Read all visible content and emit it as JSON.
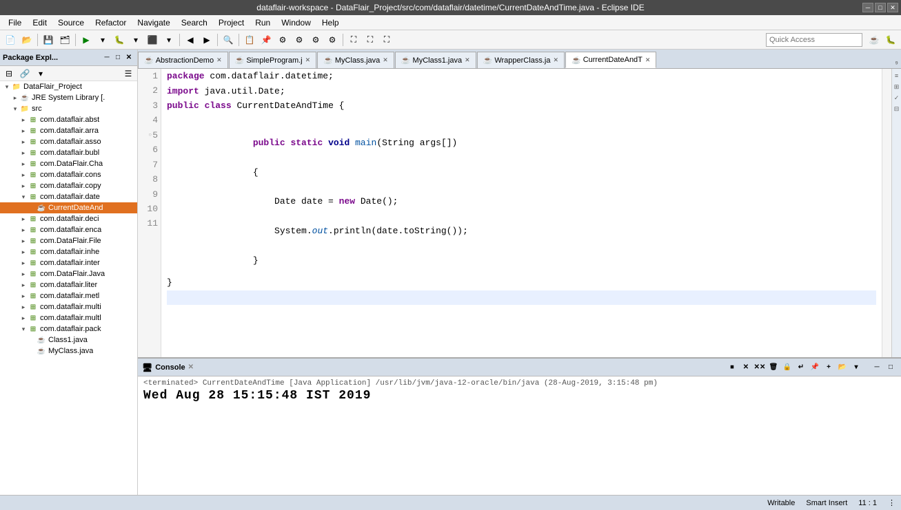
{
  "titleBar": {
    "title": "dataflair-workspace - DataFlair_Project/src/com/dataflair/datetime/CurrentDateAndTime.java - Eclipse IDE",
    "controls": [
      "minimize",
      "maximize",
      "close"
    ]
  },
  "menuBar": {
    "items": [
      "File",
      "Edit",
      "Source",
      "Refactor",
      "Navigate",
      "Search",
      "Project",
      "Run",
      "Window",
      "Help"
    ]
  },
  "toolbar": {
    "quickAccess": {
      "placeholder": "Quick Access",
      "label": "Quick Access"
    }
  },
  "packageExplorer": {
    "title": "Package Expl...",
    "tree": [
      {
        "level": 1,
        "type": "project",
        "label": "DataFlair_Project",
        "expanded": true,
        "arrow": "▾"
      },
      {
        "level": 2,
        "type": "jre",
        "label": "JRE System Library [.",
        "expanded": false,
        "arrow": "▸"
      },
      {
        "level": 2,
        "type": "folder",
        "label": "src",
        "expanded": true,
        "arrow": "▾"
      },
      {
        "level": 3,
        "type": "package",
        "label": "com.dataflair.abst",
        "expanded": false,
        "arrow": "▸"
      },
      {
        "level": 3,
        "type": "package",
        "label": "com.dataflair.arra",
        "expanded": false,
        "arrow": "▸"
      },
      {
        "level": 3,
        "type": "package",
        "label": "com.dataflair.asso",
        "expanded": false,
        "arrow": "▸"
      },
      {
        "level": 3,
        "type": "package",
        "label": "com.dataflair.bubl",
        "expanded": false,
        "arrow": "▸"
      },
      {
        "level": 3,
        "type": "package",
        "label": "com.DataFlair.Cha",
        "expanded": false,
        "arrow": "▸"
      },
      {
        "level": 3,
        "type": "package",
        "label": "com.dataflair.cons",
        "expanded": false,
        "arrow": "▸"
      },
      {
        "level": 3,
        "type": "package",
        "label": "com.dataflair.copy",
        "expanded": false,
        "arrow": "▸"
      },
      {
        "level": 3,
        "type": "package",
        "label": "com.dataflair.date",
        "expanded": true,
        "arrow": "▾"
      },
      {
        "level": 4,
        "type": "java",
        "label": "CurrentDateAnd",
        "selected": true,
        "arrow": ""
      },
      {
        "level": 3,
        "type": "package",
        "label": "com.dataflair.deci",
        "expanded": false,
        "arrow": "▸"
      },
      {
        "level": 3,
        "type": "package",
        "label": "com.dataflair.enca",
        "expanded": false,
        "arrow": "▸"
      },
      {
        "level": 3,
        "type": "package",
        "label": "com.DataFlair.File",
        "expanded": false,
        "arrow": "▸"
      },
      {
        "level": 3,
        "type": "package",
        "label": "com.dataflair.inhe",
        "expanded": false,
        "arrow": "▸"
      },
      {
        "level": 3,
        "type": "package",
        "label": "com.dataflair.inter",
        "expanded": false,
        "arrow": "▸"
      },
      {
        "level": 3,
        "type": "package",
        "label": "com.DataFlair.Java",
        "expanded": false,
        "arrow": "▸"
      },
      {
        "level": 3,
        "type": "package",
        "label": "com.dataflair.liter",
        "expanded": false,
        "arrow": "▸"
      },
      {
        "level": 3,
        "type": "package",
        "label": "com.dataflair.metl",
        "expanded": false,
        "arrow": "▸"
      },
      {
        "level": 3,
        "type": "package",
        "label": "com.dataflair.multi",
        "expanded": false,
        "arrow": "▸"
      },
      {
        "level": 3,
        "type": "package",
        "label": "com.dataflair.multl",
        "expanded": false,
        "arrow": "▸"
      },
      {
        "level": 3,
        "type": "package",
        "label": "com.dataflair.pack",
        "expanded": true,
        "arrow": "▾"
      },
      {
        "level": 4,
        "type": "java",
        "label": "Class1.java",
        "selected": false,
        "arrow": ""
      },
      {
        "level": 4,
        "type": "java",
        "label": "MyClass.java",
        "selected": false,
        "arrow": ""
      }
    ]
  },
  "editorTabs": {
    "tabs": [
      {
        "label": "AbstractionDemo",
        "active": false,
        "closable": true
      },
      {
        "label": "SimpleProgram.j",
        "active": false,
        "closable": true
      },
      {
        "label": "MyClass.java",
        "active": false,
        "closable": true
      },
      {
        "label": "MyClass1.java",
        "active": false,
        "closable": true
      },
      {
        "label": "WrapperClass.ja",
        "active": false,
        "closable": true
      },
      {
        "label": "CurrentDateAndT",
        "active": true,
        "closable": true
      }
    ],
    "extraTab": "⁹"
  },
  "codeEditor": {
    "lines": [
      {
        "num": 1,
        "content": "package com.dataflair.datetime;"
      },
      {
        "num": 2,
        "content": "import java.util.Date;"
      },
      {
        "num": 3,
        "content": "public class CurrentDateAndTime {"
      },
      {
        "num": 4,
        "content": ""
      },
      {
        "num": 5,
        "content": "    public static void main(String args[])"
      },
      {
        "num": 6,
        "content": "    {"
      },
      {
        "num": 7,
        "content": "        Date date = new Date();"
      },
      {
        "num": 8,
        "content": "        System.out.println(date.toString());"
      },
      {
        "num": 9,
        "content": "    }"
      },
      {
        "num": 10,
        "content": "}"
      },
      {
        "num": 11,
        "content": ""
      }
    ]
  },
  "console": {
    "title": "Console",
    "closeIcon": "✕",
    "terminated": "<terminated> CurrentDateAndTime [Java Application] /usr/lib/jvm/java-12-oracle/bin/java (28-Aug-2019, 3:15:48 pm)",
    "output": "Wed Aug 28 15:15:48 IST 2019"
  },
  "statusBar": {
    "writable": "Writable",
    "insertMode": "Smart Insert",
    "position": "11 : 1"
  }
}
